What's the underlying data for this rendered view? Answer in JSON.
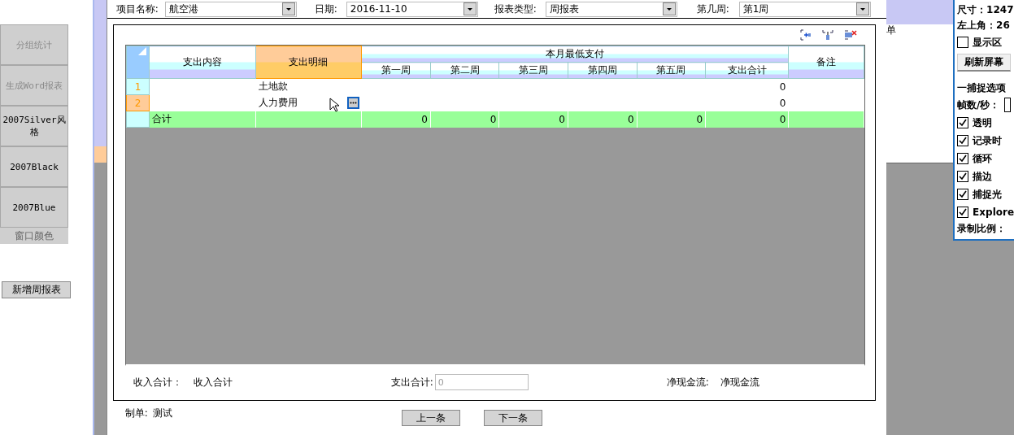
{
  "side_panel": {
    "buttons": [
      {
        "label": "分组统计",
        "disabled": true
      },
      {
        "label": "生成Word报表",
        "disabled": true
      },
      {
        "label": "2007Silver风格",
        "disabled": false
      },
      {
        "label": "2007Black",
        "disabled": false
      },
      {
        "label": "2007Blue",
        "disabled": false
      }
    ],
    "group_label": "窗口颜色",
    "add_button": "新增周报表"
  },
  "filters": [
    {
      "label": "项目名称:",
      "value": "航空港"
    },
    {
      "label": "日期:",
      "value": "2016-11-10"
    },
    {
      "label": "报表类型:",
      "value": "周报表"
    },
    {
      "label": "第几周:",
      "value": "第1周"
    }
  ],
  "grid": {
    "columns": [
      {
        "label": "支出内容",
        "selected": false
      },
      {
        "label": "支出明细",
        "selected": true
      },
      {
        "label": "本月最低支付",
        "selected": false,
        "children": [
          {
            "label": "第一周",
            "selected": false
          },
          {
            "label": "第二周",
            "selected": false
          },
          {
            "label": "第三周",
            "selected": false
          },
          {
            "label": "第四周",
            "selected": false
          },
          {
            "label": "第五周",
            "selected": false
          },
          {
            "label": "支出合计",
            "selected": false
          }
        ]
      },
      {
        "label": "备注",
        "selected": false
      }
    ],
    "rows": [
      {
        "number": "1",
        "selected": false,
        "detail": "土地款",
        "total": "0",
        "editing": false
      },
      {
        "number": "2",
        "selected": true,
        "detail": "人力费用",
        "total": "0",
        "editing": true
      }
    ],
    "total_row": {
      "label": "合计",
      "weeks": [
        "0",
        "0",
        "0",
        "0",
        "0"
      ],
      "total": "0"
    }
  },
  "summary": {
    "income": {
      "label": "收入合计：",
      "value": "收入合计"
    },
    "expense": {
      "label": "支出合计:",
      "placeholder": "0"
    },
    "net": {
      "label": "净现金流:",
      "value": "净现金流"
    }
  },
  "maker": {
    "label": "制单:",
    "value": "测试"
  },
  "nav_buttons": [
    "上一条",
    "下一条"
  ],
  "background_window": {
    "text": "单"
  },
  "recorder": {
    "size": "尺寸：1247",
    "origin": "左上角：26",
    "show_region": {
      "label": "显示区",
      "checked": false
    },
    "refresh_button": "刷新屏幕",
    "section": "一捕捉选项",
    "fps_label": "帧数/秒：",
    "options": [
      {
        "label": "透明",
        "checked": true
      },
      {
        "label": "记录时",
        "checked": true
      },
      {
        "label": "循环",
        "checked": true
      },
      {
        "label": "描边",
        "checked": true
      },
      {
        "label": "捕捉光",
        "checked": true
      },
      {
        "label": "Explore",
        "checked": true
      }
    ],
    "scale_label": "录制比例："
  }
}
